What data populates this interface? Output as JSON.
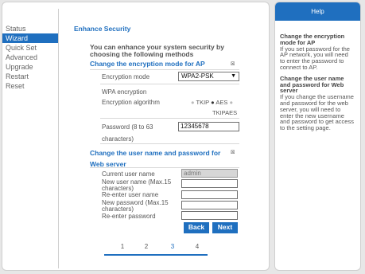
{
  "sidebar": {
    "items": [
      {
        "label": "Status",
        "active": false
      },
      {
        "label": "Wizard",
        "active": true
      },
      {
        "label": "Quick Set",
        "active": false
      },
      {
        "label": "Advanced",
        "active": false
      },
      {
        "label": "Upgrade",
        "active": false
      },
      {
        "label": "Restart",
        "active": false
      },
      {
        "label": "Reset",
        "active": false
      }
    ]
  },
  "main": {
    "title": "Enhance Security",
    "intro": "You can enhance your system security by choosing the following methods",
    "ap_section": {
      "heading": "Change the encryption mode for AP",
      "checked": true,
      "encryption_mode_label": "Encryption mode",
      "encryption_mode_value": "WPA2-PSK",
      "wpa_encryption_label": "WPA encryption",
      "algorithm_label": "Encryption algorithm",
      "algorithm_options": [
        "TKIP",
        "AES",
        "TKIPAES"
      ],
      "algorithm_selected": "AES",
      "password_label_line1": "Password (8 to 63",
      "password_label_line2": "characters)",
      "password_value": "12345678"
    },
    "web_section": {
      "heading_line1": "Change the user name and password for",
      "heading_line2": "Web server",
      "checked": true,
      "current_user_label": "Current user name",
      "current_user_value": "admin",
      "new_user_label": "New user name (Max.15 characters)",
      "reenter_user_label": "Re-enter user name",
      "new_password_label": "New password (Max.15 characters)",
      "reenter_password_label": "Re-enter password"
    },
    "buttons": {
      "back": "Back",
      "next": "Next"
    },
    "pager": {
      "pages": [
        "1",
        "2",
        "3",
        "4"
      ],
      "current": "3"
    }
  },
  "help": {
    "title": "Help",
    "sections": [
      {
        "heading": "Change the encryption mode for AP",
        "text": "If you set password for the AP network, you will need to enter the password to connect to AP."
      },
      {
        "heading": "Change the user name and password for Web server",
        "text": "If you change the username and password for the web server, you will need to enter the new username and password to get access to the setting page."
      }
    ]
  },
  "colors": {
    "accent": "#1f6fbf",
    "background": "#e7e7e7",
    "panel": "#ffffff"
  }
}
